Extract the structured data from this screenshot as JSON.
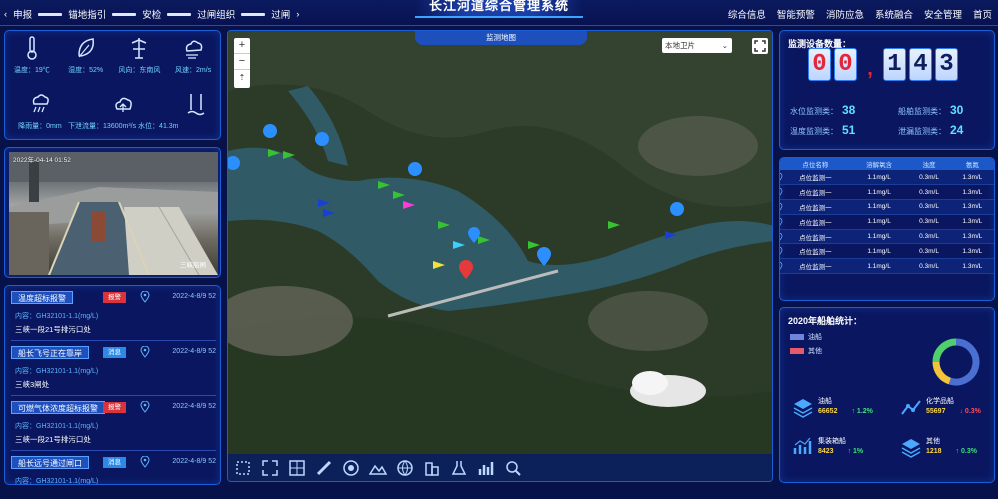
{
  "header": {
    "title": "长江河道综合管理系统",
    "left_nav": [
      "申报",
      "锚地指引",
      "安检",
      "过闸组织",
      "过闸"
    ],
    "right_nav": [
      "综合信息",
      "智能预警",
      "消防应急",
      "系统融合",
      "安全管理",
      "首页"
    ]
  },
  "weather": {
    "items": [
      {
        "icon": "thermometer-icon",
        "text": "温度：19℃"
      },
      {
        "icon": "humidity-leaf-icon",
        "text": "湿度：52%"
      },
      {
        "icon": "wind-vane-icon",
        "text": "风向：东南风"
      },
      {
        "icon": "wind-cloud-icon",
        "text": "风速：2m/s"
      }
    ],
    "items2": [
      {
        "icon": "rain-icon",
        "text": "降雨量：0mm"
      },
      {
        "icon": "cloud-upload-icon",
        "text": "下泄流量：13600m³/s  水位：41.3m"
      },
      {
        "icon": "water-level-icon",
        "text": ""
      }
    ]
  },
  "camera": {
    "timestamp": "2022年-04-14 01:52",
    "footer": "三峡船闸"
  },
  "alerts": [
    {
      "title": "温度超标报警",
      "badge": "报警",
      "badge_type": "red",
      "date": "2022-4-8/9 52",
      "content": "内容：GH32101-1.1(mg/L)",
      "location": "三峡一段21号排污口处"
    },
    {
      "title": "船长飞号正在靠岸",
      "badge": "消息",
      "badge_type": "blue",
      "date": "2022-4-8/9 52",
      "content": "内容：GH32101-1.1(mg/L)",
      "location": "三峡3闸处"
    },
    {
      "title": "可燃气体浓度超标报警",
      "badge": "报警",
      "badge_type": "red",
      "date": "2022-4-8/9 52",
      "content": "内容：GH32101-1.1(mg/L)",
      "location": "三峡一段21号排污口处"
    },
    {
      "title": "船长远号通过闸口",
      "badge": "消息",
      "badge_type": "blue",
      "date": "2022-4-8/9 52",
      "content": "内容：GH32101-1.1(mg/L)",
      "location": ""
    }
  ],
  "map": {
    "tab": "监测地图",
    "layer_select": "本地卫片",
    "zoom_in": "+",
    "zoom_out": "−"
  },
  "stats": {
    "title": "监测设备数量：",
    "digits": [
      "0",
      "0",
      "1",
      "4",
      "3"
    ],
    "comma": ",",
    "rows": [
      {
        "label": "水位监测类：",
        "value": "38"
      },
      {
        "label": "船舶监测类：",
        "value": "30"
      },
      {
        "label": "温度监测类：",
        "value": "51"
      },
      {
        "label": "泄漏监测类：",
        "value": "24"
      }
    ]
  },
  "table": {
    "headers": [
      "点位名称",
      "溶解氧含",
      "浊度",
      "氨氮"
    ],
    "rows": [
      [
        "点位监测一",
        "1.1mg/L",
        "0.3m/L",
        "1.3m/L"
      ],
      [
        "点位监测一",
        "1.1mg/L",
        "0.3m/L",
        "1.3m/L"
      ],
      [
        "点位监测一",
        "1.1mg/L",
        "0.3m/L",
        "1.3m/L"
      ],
      [
        "点位监测一",
        "1.1mg/L",
        "0.3m/L",
        "1.3m/L"
      ],
      [
        "点位监测一",
        "1.1mg/L",
        "0.3m/L",
        "1.3m/L"
      ],
      [
        "点位监测一",
        "1.1mg/L",
        "0.3m/L",
        "1.3m/L"
      ],
      [
        "点位监测一",
        "1.1mg/L",
        "0.3m/L",
        "1.3m/L"
      ]
    ]
  },
  "ships": {
    "title": "2020年船舶统计：",
    "legend": [
      {
        "label": "油船",
        "color": "#6d86d9"
      },
      {
        "label": "其他",
        "color": "#e65a6a"
      }
    ],
    "donut": [
      {
        "label": "油船",
        "fraction": 0.55,
        "color": "#4a6fd1"
      },
      {
        "label": "化学品船",
        "fraction": 0.2,
        "color": "#f2c43a"
      },
      {
        "label": "其他",
        "fraction": 0.25,
        "color": "#4fd06b"
      }
    ],
    "cells": [
      {
        "name": "油船",
        "value": "66652",
        "trend": "up",
        "pct": "1.2%"
      },
      {
        "name": "化学品船",
        "value": "55697",
        "trend": "down",
        "pct": "0.3%"
      },
      {
        "name": "集装箱船",
        "value": "8423",
        "trend": "up",
        "pct": "1%"
      },
      {
        "name": "其他",
        "value": "1218",
        "trend": "up",
        "pct": "0.3%"
      }
    ]
  }
}
